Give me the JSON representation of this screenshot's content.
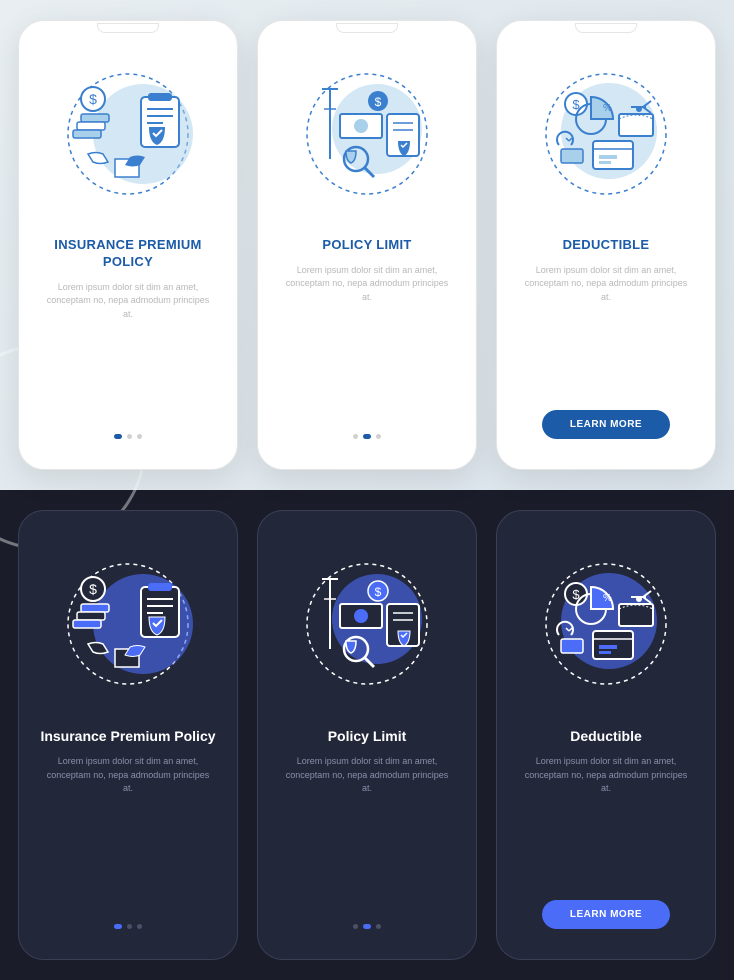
{
  "body_text": "Lorem ipsum dolor sit dim an amet, conceptam no, nepa admodum principes at.",
  "btn_label": "LEARN MORE",
  "light": {
    "screens": [
      {
        "title": "INSURANCE PREMIUM POLICY",
        "icon": "premium"
      },
      {
        "title": "POLICY LIMIT",
        "icon": "limit"
      },
      {
        "title": "DEDUCTIBLE",
        "icon": "deductible"
      }
    ]
  },
  "dark": {
    "screens": [
      {
        "title": "Insurance Premium Policy",
        "icon": "premium"
      },
      {
        "title": "Policy Limit",
        "icon": "limit"
      },
      {
        "title": "Deductible",
        "icon": "deductible"
      }
    ]
  },
  "colors": {
    "light_accent": "#1b5ba8",
    "dark_accent": "#4a6cf7",
    "illus_stroke_light": "#3b7fcf",
    "illus_stroke_dark": "#ffffff",
    "illus_fill_light": "#a8d0ea",
    "illus_fill_dark": "#4a6cf7"
  }
}
